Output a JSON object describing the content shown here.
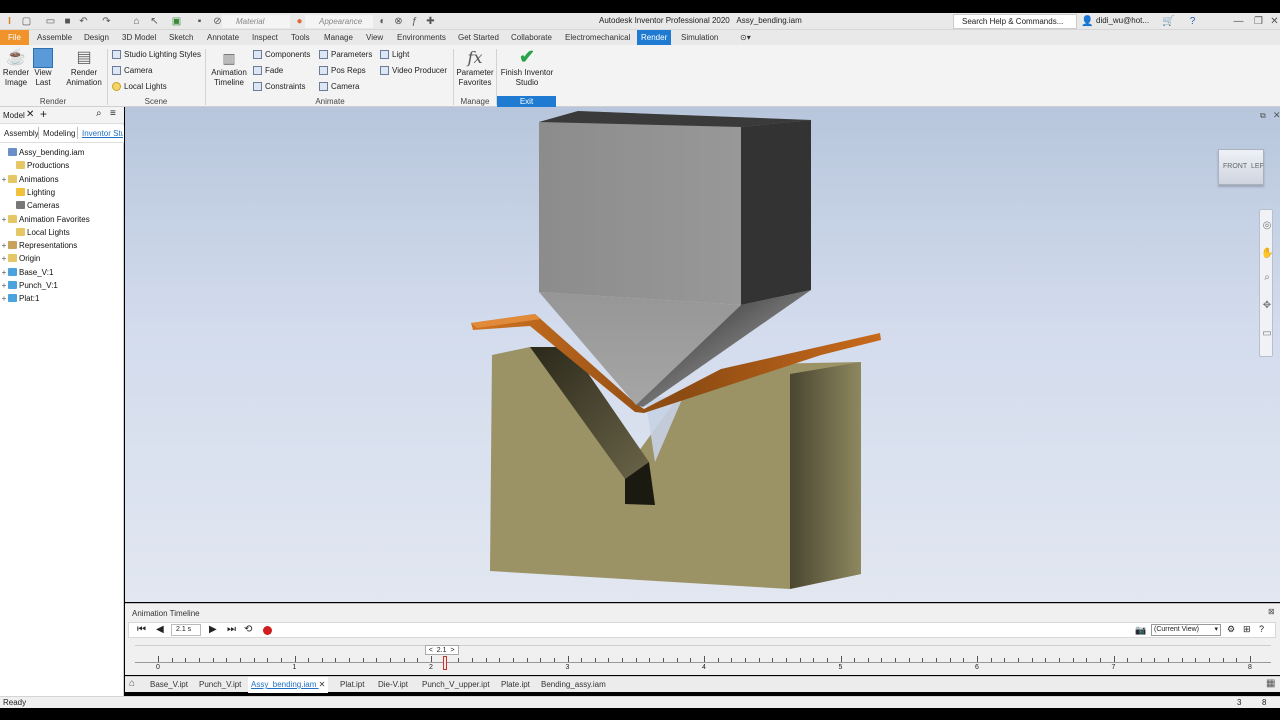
{
  "app": {
    "title": "Autodesk Inventor Professional 2020",
    "document": "Assy_bending.iam"
  },
  "quick_access": {
    "material_placeholder": "Material",
    "appearance_placeholder": "Appearance",
    "search_placeholder": "Search Help & Commands...",
    "user": "didi_wu@hot..."
  },
  "tabs": [
    {
      "label": "File"
    },
    {
      "label": "Assemble"
    },
    {
      "label": "Design"
    },
    {
      "label": "3D Model"
    },
    {
      "label": "Sketch"
    },
    {
      "label": "Annotate"
    },
    {
      "label": "Inspect"
    },
    {
      "label": "Tools"
    },
    {
      "label": "Manage"
    },
    {
      "label": "View"
    },
    {
      "label": "Environments"
    },
    {
      "label": "Get Started"
    },
    {
      "label": "Collaborate"
    },
    {
      "label": "Electromechanical"
    },
    {
      "label": "Render"
    },
    {
      "label": "Simulation"
    }
  ],
  "ribbon": {
    "render_image": "Render Image",
    "view_last": "View Last",
    "render_animation": "Render Animation",
    "group_render": "Render",
    "studio_lighting": "Studio Lighting Styles",
    "camera": "Camera",
    "local_lights": "Local Lights",
    "group_scene": "Scene",
    "animation_timeline": "Animation Timeline",
    "components": "Components",
    "fade": "Fade",
    "constraints": "Constraints",
    "parameters": "Parameters",
    "pos_reps": "Pos Reps",
    "camera2": "Camera",
    "light": "Light",
    "video_producer": "Video Producer",
    "group_animate": "Animate",
    "parameter_favorites": "Parameter Favorites",
    "group_manage": "Manage",
    "finish_studio": "Finish Inventor Studio",
    "group_exit": "Exit"
  },
  "browser": {
    "title": "Model",
    "subtabs": [
      "Assembly",
      "Modeling",
      "Inventor Stu"
    ],
    "tree": [
      {
        "label": "Assy_bending.iam",
        "indent": 0,
        "expander": "",
        "color": "#6b8fc7"
      },
      {
        "label": "Productions",
        "indent": 1,
        "expander": "",
        "color": "#e5c766"
      },
      {
        "label": "Animations",
        "indent": 0,
        "expander": "+",
        "color": "#e5c766"
      },
      {
        "label": "Lighting",
        "indent": 1,
        "expander": "",
        "color": "#f2c13a"
      },
      {
        "label": "Cameras",
        "indent": 1,
        "expander": "",
        "color": "#777777"
      },
      {
        "label": "Animation Favorites",
        "indent": 0,
        "expander": "+",
        "color": "#e5c766"
      },
      {
        "label": "Local Lights",
        "indent": 1,
        "expander": "",
        "color": "#e5c766"
      },
      {
        "label": "Representations",
        "indent": 0,
        "expander": "+",
        "color": "#c9a15a"
      },
      {
        "label": "Origin",
        "indent": 0,
        "expander": "+",
        "color": "#e5c766"
      },
      {
        "label": "Base_V:1",
        "indent": 0,
        "expander": "+",
        "color": "#4aa3df"
      },
      {
        "label": "Punch_V:1",
        "indent": 0,
        "expander": "+",
        "color": "#4aa3df"
      },
      {
        "label": "Plat:1",
        "indent": 0,
        "expander": "+",
        "color": "#4aa3df"
      }
    ]
  },
  "viewcube": {
    "front": "FRONT",
    "side": "LEF"
  },
  "timeline": {
    "title": "Animation Timeline",
    "time_value": "2.1 s",
    "view_select": "(Current View)",
    "marker": "2.1",
    "ticks": [
      "0",
      "1",
      "2",
      "3",
      "4",
      "5",
      "6",
      "7",
      "8"
    ],
    "current_time": 2.1,
    "max_time": 8
  },
  "document_tabs": [
    "Base_V.ipt",
    "Punch_V.ipt",
    "Assy_bending.iam",
    "Plat.ipt",
    "Die-V.ipt",
    "Punch_V_upper.ipt",
    "Plate.ipt",
    "Bending_assy.iam"
  ],
  "status": {
    "text": "Ready",
    "count_a": "3",
    "count_b": "8"
  },
  "colors": {
    "accent": "#1f7bd1",
    "file_tab": "#f0932b",
    "die": "#9b9266",
    "punch": "#8f8f8f",
    "plate": "#c96a1c"
  }
}
